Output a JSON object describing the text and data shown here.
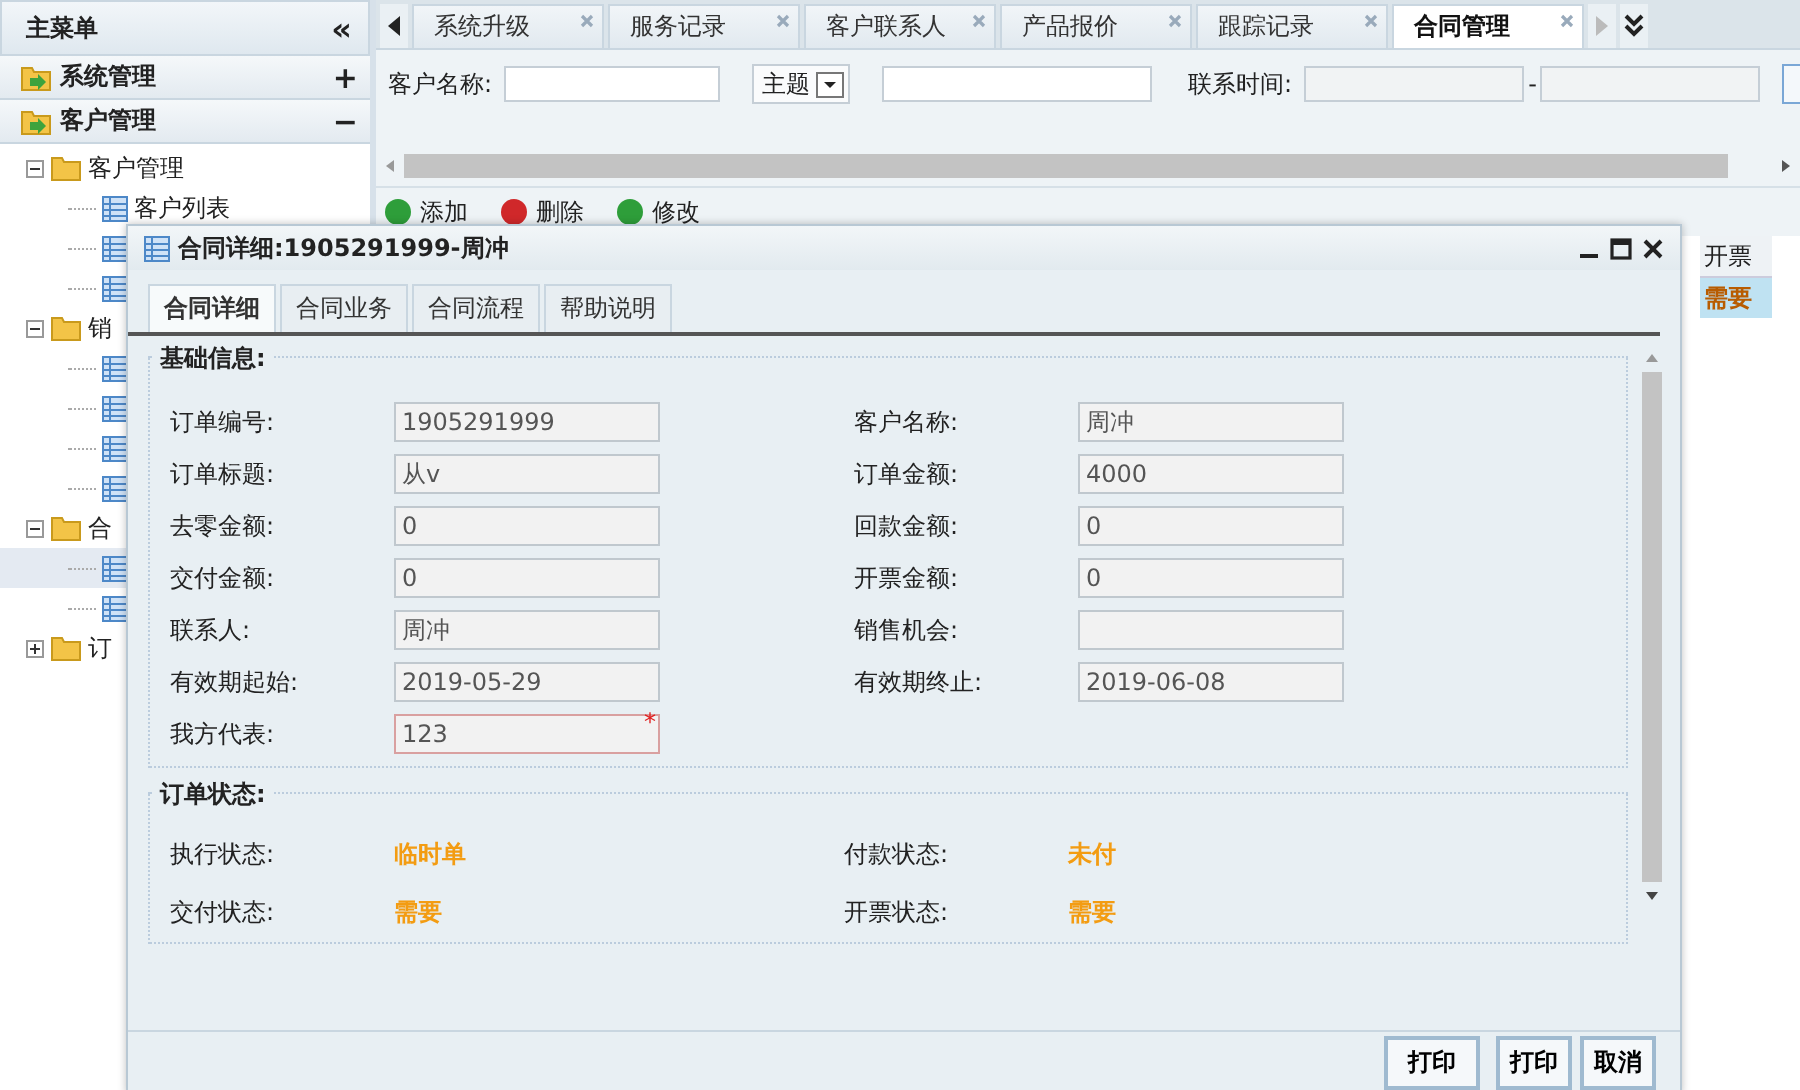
{
  "sidebar": {
    "title": "主菜单",
    "collapse": "«",
    "groups": [
      {
        "label": "系统管理",
        "toggle": "+"
      },
      {
        "label": "客户管理",
        "toggle": "−"
      }
    ],
    "tree": [
      {
        "label": "客户管理",
        "expanded": true,
        "children": [
          {
            "label": "客户列表",
            "selected": false
          },
          {
            "selected": false
          },
          {
            "selected": false
          }
        ]
      },
      {
        "label": "销",
        "expanded": true,
        "children": [
          {
            "selected": false
          },
          {
            "selected": false
          },
          {
            "selected": false
          },
          {
            "selected": false
          }
        ]
      },
      {
        "label": "合",
        "expanded": true,
        "children": [
          {
            "selected": true
          },
          {
            "selected": false
          }
        ]
      },
      {
        "label": "订",
        "expanded": false
      }
    ]
  },
  "tabs": [
    {
      "label": "系统升级",
      "selected": false
    },
    {
      "label": "服务记录",
      "selected": false
    },
    {
      "label": "客户联系人",
      "selected": false
    },
    {
      "label": "产品报价",
      "selected": false
    },
    {
      "label": "跟踪记录",
      "selected": false
    },
    {
      "label": "合同管理",
      "selected": true
    }
  ],
  "search": {
    "name_label": "客户名称:",
    "topic": "主题",
    "time_label": "联系时间:",
    "range_sep": "-"
  },
  "toolbar": [
    {
      "label": "添加",
      "kind": "add"
    },
    {
      "label": "删除",
      "kind": "delete"
    },
    {
      "label": "修改",
      "kind": "edit"
    }
  ],
  "grid": {
    "columns": [
      "开票"
    ],
    "rows": [
      {
        "cells": [
          "需要"
        ],
        "selected": true
      }
    ]
  },
  "dialog": {
    "title": "合同详细:1905291999-周冲",
    "tabs": [
      {
        "label": "合同详细",
        "selected": true
      },
      {
        "label": "合同业务",
        "selected": false
      },
      {
        "label": "合同流程",
        "selected": false
      },
      {
        "label": "帮助说明",
        "selected": false
      }
    ],
    "basic": {
      "legend": "基础信息:",
      "fields": [
        {
          "label": "订单编号:",
          "value": "1905291999",
          "required": false
        },
        {
          "label": "客户名称:",
          "value": "周冲",
          "required": false
        },
        {
          "label": "订单标题:",
          "value": "从v",
          "required": false
        },
        {
          "label": "订单金额:",
          "value": "4000",
          "required": false
        },
        {
          "label": "去零金额:",
          "value": "0",
          "required": false
        },
        {
          "label": "回款金额:",
          "value": "0",
          "required": false
        },
        {
          "label": "交付金额:",
          "value": "0",
          "required": false
        },
        {
          "label": "开票金额:",
          "value": "0",
          "required": false
        },
        {
          "label": "联系人:",
          "value": "周冲",
          "required": false
        },
        {
          "label": "销售机会:",
          "required": false
        },
        {
          "label": "有效期起始:",
          "value": "2019-05-29",
          "required": false
        },
        {
          "label": "有效期终止:",
          "value": "2019-06-08",
          "required": false
        },
        {
          "label": "我方代表:",
          "value": "123",
          "required": true,
          "mark": "*"
        }
      ]
    },
    "status": {
      "legend": "订单状态:",
      "items": [
        {
          "label": "执行状态:",
          "value": "临时单"
        },
        {
          "label": "付款状态:",
          "value": "未付"
        },
        {
          "label": "交付状态:",
          "value": "需要"
        },
        {
          "label": "开票状态:",
          "value": "需要"
        }
      ]
    },
    "buttons": [
      "打印",
      "打印",
      "取消"
    ]
  }
}
